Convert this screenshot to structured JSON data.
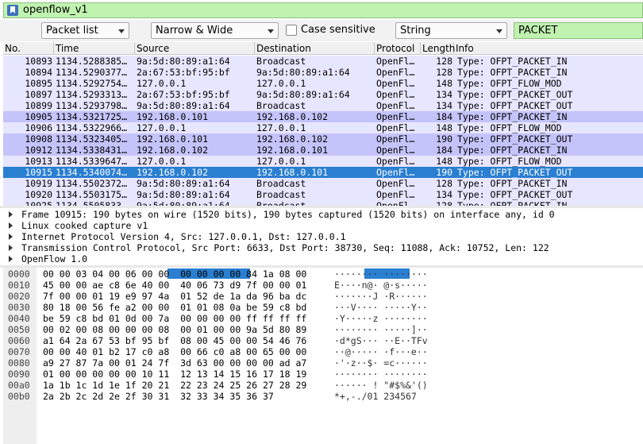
{
  "filter": {
    "value": "openflow_v1",
    "bookmark_icon": "bookmark-icon"
  },
  "find": {
    "search_in": "Packet list",
    "char_width": "Narrow & Wide",
    "case_sensitive_label": "Case sensitive",
    "search_type": "String",
    "search_value": "PACKET"
  },
  "colors": {
    "row_light": "#e7e6ff",
    "row_dark": "#c4c3fa",
    "row_selected": "#2a7fd1",
    "filter_bg": "#c0f2b0"
  },
  "packet_list": {
    "columns": [
      "No.",
      "Time",
      "Source",
      "Destination",
      "Protocol",
      "Length",
      "Info"
    ],
    "rows": [
      {
        "no": "10893",
        "time": "1134.5288385…",
        "src": "9a:5d:80:89:a1:64",
        "dst": "Broadcast",
        "proto": "OpenFl…",
        "len": "128",
        "info": "Type: OFPT_PACKET_IN",
        "shade": "light"
      },
      {
        "no": "10894",
        "time": "1134.5290377…",
        "src": "2a:67:53:bf:95:bf",
        "dst": "9a:5d:80:89:a1:64",
        "proto": "OpenFl…",
        "len": "128",
        "info": "Type: OFPT_PACKET_IN",
        "shade": "light"
      },
      {
        "no": "10895",
        "time": "1134.5292754…",
        "src": "127.0.0.1",
        "dst": "127.0.0.1",
        "proto": "OpenFl…",
        "len": "148",
        "info": "Type: OFPT_FLOW_MOD",
        "shade": "light"
      },
      {
        "no": "10897",
        "time": "1134.5293313…",
        "src": "2a:67:53:bf:95:bf",
        "dst": "9a:5d:80:89:a1:64",
        "proto": "OpenFl…",
        "len": "134",
        "info": "Type: OFPT_PACKET_OUT",
        "shade": "light"
      },
      {
        "no": "10899",
        "time": "1134.5293798…",
        "src": "9a:5d:80:89:a1:64",
        "dst": "Broadcast",
        "proto": "OpenFl…",
        "len": "134",
        "info": "Type: OFPT_PACKET_OUT",
        "shade": "light"
      },
      {
        "no": "10905",
        "time": "1134.5321725…",
        "src": "192.168.0.101",
        "dst": "192.168.0.102",
        "proto": "OpenFl…",
        "len": "184",
        "info": "Type: OFPT_PACKET_IN",
        "shade": "dark"
      },
      {
        "no": "10906",
        "time": "1134.5322966…",
        "src": "127.0.0.1",
        "dst": "127.0.0.1",
        "proto": "OpenFl…",
        "len": "148",
        "info": "Type: OFPT_FLOW_MOD",
        "shade": "light"
      },
      {
        "no": "10908",
        "time": "1134.5323405…",
        "src": "192.168.0.101",
        "dst": "192.168.0.102",
        "proto": "OpenFl…",
        "len": "190",
        "info": "Type: OFPT_PACKET_OUT",
        "shade": "dark"
      },
      {
        "no": "10912",
        "time": "1134.5338431…",
        "src": "192.168.0.102",
        "dst": "192.168.0.101",
        "proto": "OpenFl…",
        "len": "184",
        "info": "Type: OFPT_PACKET_IN",
        "shade": "dark"
      },
      {
        "no": "10913",
        "time": "1134.5339647…",
        "src": "127.0.0.1",
        "dst": "127.0.0.1",
        "proto": "OpenFl…",
        "len": "148",
        "info": "Type: OFPT_FLOW_MOD",
        "shade": "light"
      },
      {
        "no": "10915",
        "time": "1134.5340074…",
        "src": "192.168.0.102",
        "dst": "192.168.0.101",
        "proto": "OpenFl…",
        "len": "190",
        "info": "Type: OFPT_PACKET_OUT",
        "shade": "selected"
      },
      {
        "no": "10919",
        "time": "1134.5502372…",
        "src": "9a:5d:80:89:a1:64",
        "dst": "Broadcast",
        "proto": "OpenFl…",
        "len": "128",
        "info": "Type: OFPT_PACKET_IN",
        "shade": "light"
      },
      {
        "no": "10920",
        "time": "1134.5503175…",
        "src": "9a:5d:80:89:a1:64",
        "dst": "Broadcast",
        "proto": "OpenFl…",
        "len": "134",
        "info": "Type: OFPT_PACKET_OUT",
        "shade": "light"
      },
      {
        "no": "10925",
        "time": "1134.5505833…",
        "src": "9a:5d:80:89:a1:64",
        "dst": "Broadcast",
        "proto": "OpenFl…",
        "len": "128",
        "info": "Type: OFPT_PACKET_IN",
        "shade": "light"
      }
    ]
  },
  "details": [
    "Frame 10915: 190 bytes on wire (1520 bits), 190 bytes captured (1520 bits) on interface any, id 0",
    "Linux cooked capture v1",
    "Internet Protocol Version 4, Src: 127.0.0.1, Dst: 127.0.0.1",
    "Transmission Control Protocol, Src Port: 6633, Dst Port: 38730, Seq: 11088, Ack: 10752, Len: 122",
    "OpenFlow 1.0"
  ],
  "bytes": [
    {
      "off": "0000",
      "hex": "00 00 03 04 00 06 00 00  00 00 00 00 84 1a 08 00",
      "ascii": "········ ········"
    },
    {
      "off": "0010",
      "hex": "45 00 00 ae c8 6e 40 00  40 06 73 d9 7f 00 00 01",
      "ascii": "E····n@· @·s·····"
    },
    {
      "off": "0020",
      "hex": "7f 00 00 01 19 e9 97 4a  01 52 de 1a da 96 ba dc",
      "ascii": "·······J ·R······"
    },
    {
      "off": "0030",
      "hex": "80 18 00 56 fe a2 00 00  01 01 08 0a be 59 c8 bd",
      "ascii": "···V···· ·····Y··"
    },
    {
      "off": "0040",
      "hex": "be 59 c8 bd 01 0d 00 7a  00 00 00 00 ff ff ff ff",
      "ascii": "·Y·····z ········"
    },
    {
      "off": "0050",
      "hex": "00 02 00 08 00 00 00 08  00 01 00 00 9a 5d 80 89",
      "ascii": "········ ·····]··"
    },
    {
      "off": "0060",
      "hex": "a1 64 2a 67 53 bf 95 bf  08 00 45 00 00 54 46 76",
      "ascii": "·d*gS··· ··E··TFv"
    },
    {
      "off": "0070",
      "hex": "00 00 40 01 b2 17 c0 a8  00 66 c0 a8 00 65 00 00",
      "ascii": "··@····· ·f···e··"
    },
    {
      "off": "0080",
      "hex": "a9 27 87 7a 00 01 24 7f  3d 63 00 00 00 00 ad a7",
      "ascii": "·'·z··$· =c······"
    },
    {
      "off": "0090",
      "hex": "01 00 00 00 00 00 10 11  12 13 14 15 16 17 18 19",
      "ascii": "········ ········"
    },
    {
      "off": "00a0",
      "hex": "1a 1b 1c 1d 1e 1f 20 21  22 23 24 25 26 27 28 29",
      "ascii": "······ ! \"#$%&'()"
    },
    {
      "off": "00b0",
      "hex": "2a 2b 2c 2d 2e 2f 30 31  32 33 34 35 36 37",
      "ascii": "*+,-./01 234567"
    }
  ]
}
